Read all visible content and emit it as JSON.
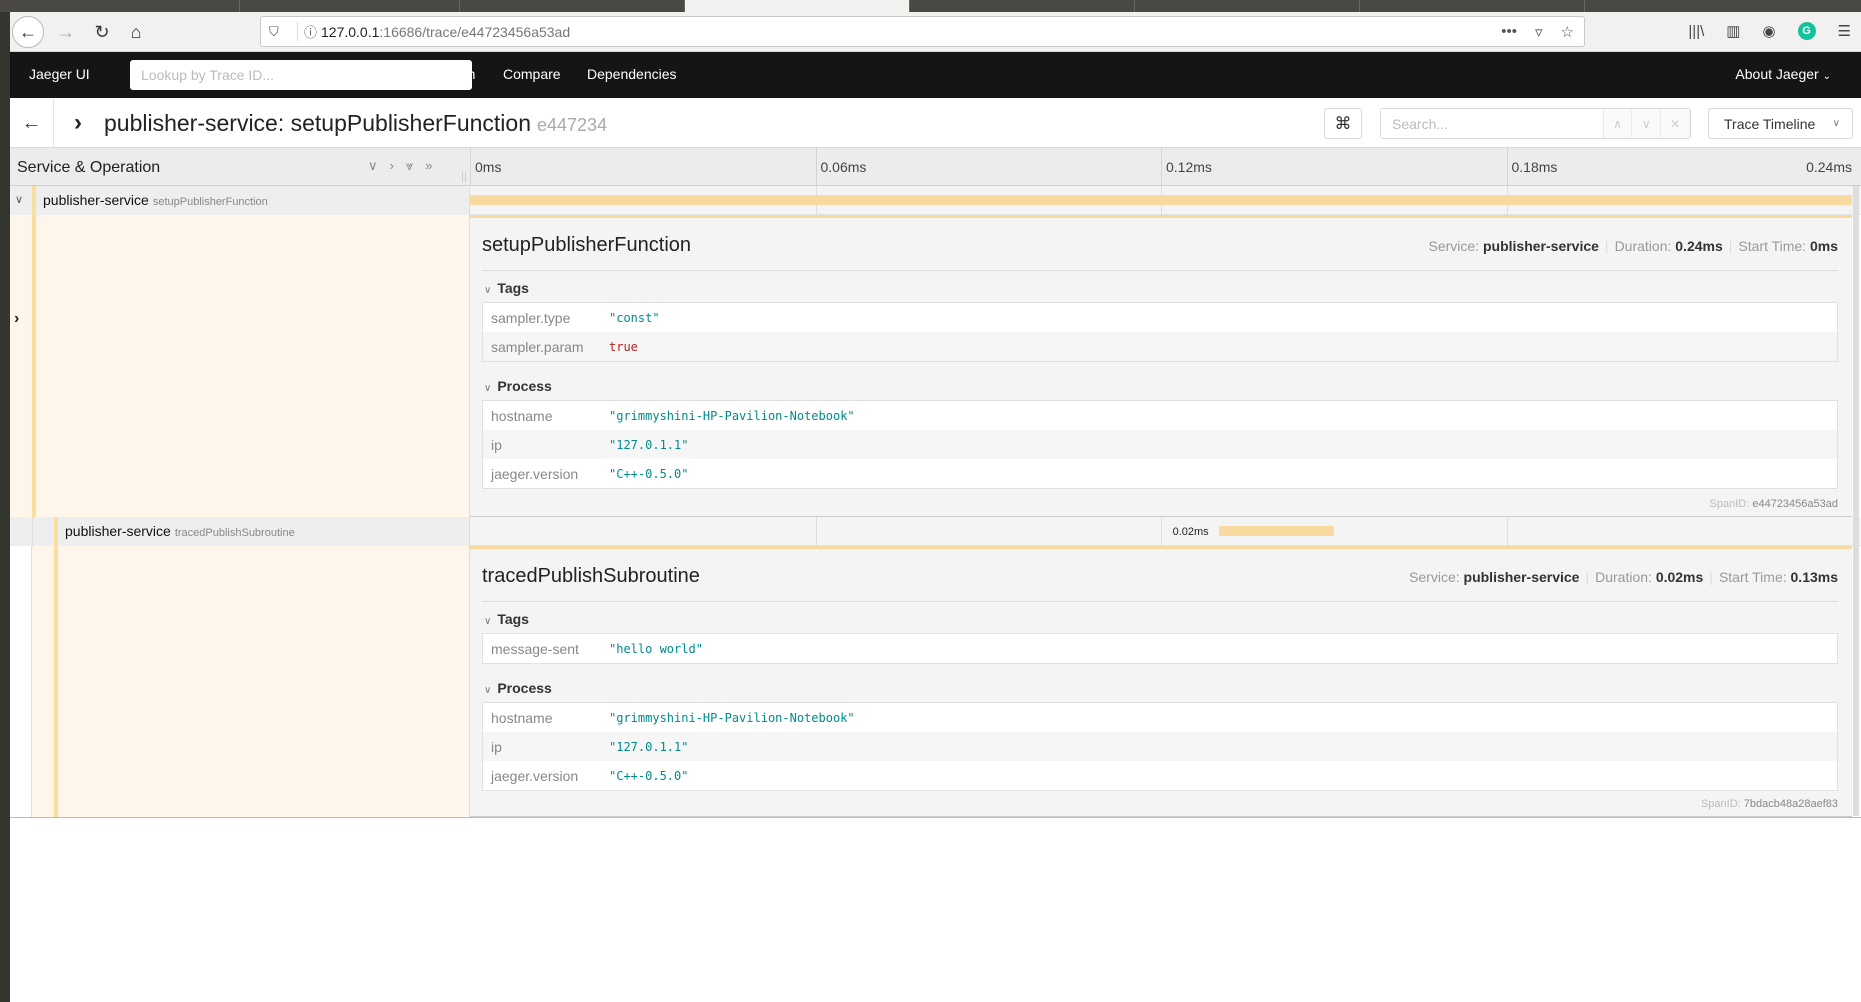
{
  "browser": {
    "url_host": "127.0.0.1",
    "url_rest": ":16686/trace/e44723456a53ad",
    "icons": [
      "back-icon",
      "forward-icon",
      "reload-icon",
      "home-icon",
      "shield-icon",
      "info-icon",
      "more-icon",
      "pocket-icon",
      "star-icon",
      "library-icon",
      "sidebar-icon",
      "account-icon",
      "grammarly-icon",
      "menu-icon"
    ]
  },
  "topnav": {
    "brand": "Jaeger UI",
    "lookup_placeholder": "Lookup by Trace ID...",
    "menu": [
      "Search",
      "Compare",
      "Dependencies"
    ],
    "about": "About Jaeger"
  },
  "trace_header": {
    "title": "publisher-service: setupPublisherFunction",
    "trace_id_short": "e447234",
    "search_placeholder": "Search...",
    "view_mode": "Trace Timeline"
  },
  "timeline_header": {
    "column_label": "Service & Operation",
    "ticks": [
      "0ms",
      "0.06ms",
      "0.12ms",
      "0.18ms",
      "0.24ms"
    ]
  },
  "trace_total_ms": 0.24,
  "spans": [
    {
      "service": "publisher-service",
      "operation": "setupPublisherFunction",
      "start_ms": 0,
      "duration_ms": 0.24,
      "duration_label": "",
      "meta": {
        "service_label": "Service:",
        "service": "publisher-service",
        "duration_label": "Duration:",
        "duration": "0.24ms",
        "start_label": "Start Time:",
        "start": "0ms"
      },
      "tags_title": "Tags",
      "tags": [
        {
          "key": "sampler.type",
          "value": "\"const\"",
          "type": "string"
        },
        {
          "key": "sampler.param",
          "value": "true",
          "type": "bool"
        }
      ],
      "process_title": "Process",
      "process": [
        {
          "key": "hostname",
          "value": "\"grimmyshini-HP-Pavilion-Notebook\""
        },
        {
          "key": "ip",
          "value": "\"127.0.1.1\""
        },
        {
          "key": "jaeger.version",
          "value": "\"C++-0.5.0\""
        }
      ],
      "span_id_label": "SpanID:",
      "span_id": "e44723456a53ad"
    },
    {
      "service": "publisher-service",
      "operation": "tracedPublishSubroutine",
      "start_ms": 0.13,
      "duration_ms": 0.02,
      "duration_label": "0.02ms",
      "meta": {
        "service_label": "Service:",
        "service": "publisher-service",
        "duration_label": "Duration:",
        "duration": "0.02ms",
        "start_label": "Start Time:",
        "start": "0.13ms"
      },
      "tags_title": "Tags",
      "tags": [
        {
          "key": "message-sent",
          "value": "\"hello world\"",
          "type": "string"
        }
      ],
      "process_title": "Process",
      "process": [
        {
          "key": "hostname",
          "value": "\"grimmyshini-HP-Pavilion-Notebook\""
        },
        {
          "key": "ip",
          "value": "\"127.0.1.1\""
        },
        {
          "key": "jaeger.version",
          "value": "\"C++-0.5.0\""
        }
      ],
      "span_id_label": "SpanID:",
      "span_id": "7bdacb48a28aef83"
    }
  ]
}
